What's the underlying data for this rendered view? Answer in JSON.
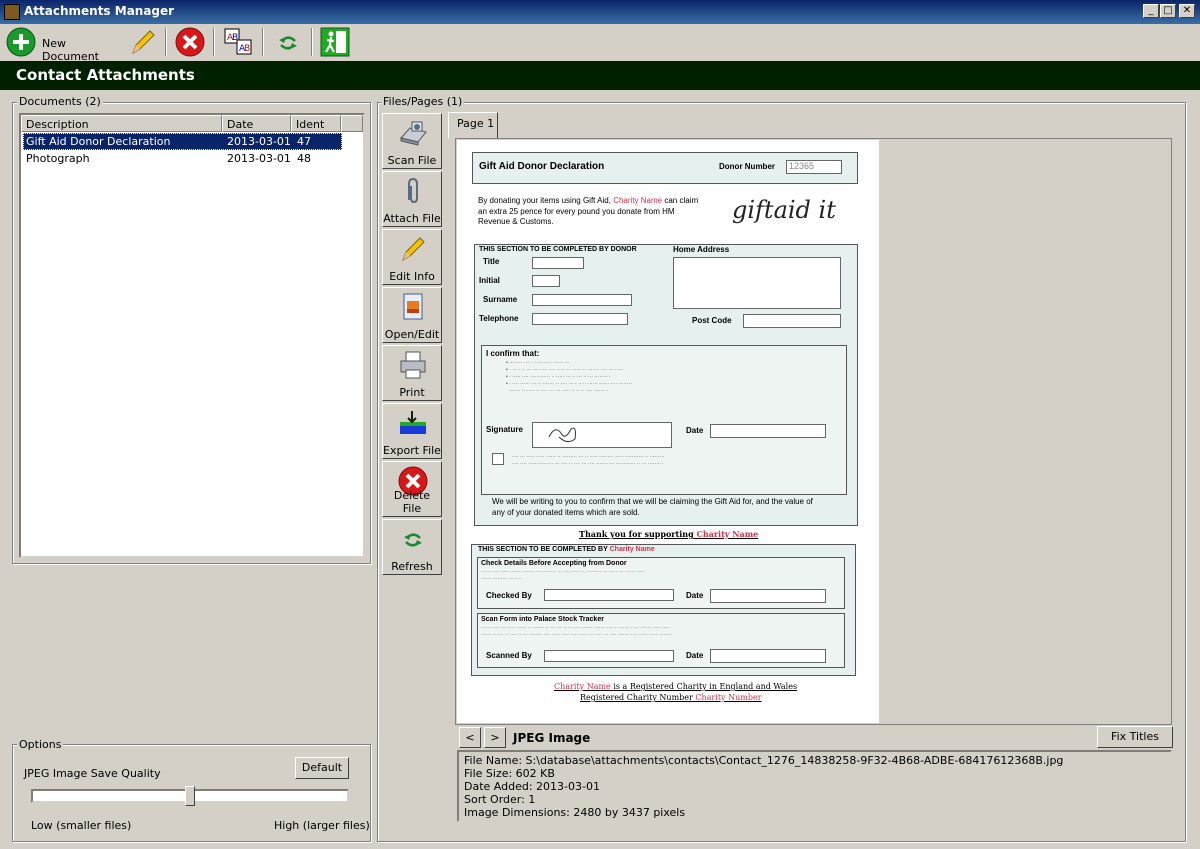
{
  "window": {
    "title": "Attachments Manager",
    "controls": [
      "_",
      "□",
      "✕"
    ]
  },
  "toolbar": {
    "new_document_label": "New Document"
  },
  "header": {
    "title": "Contact Attachments"
  },
  "documents": {
    "group_label": "Documents (2)",
    "columns": [
      "Description",
      "Date",
      "Ident"
    ],
    "rows": [
      {
        "description": "Gift Aid Donor Declaration",
        "date": "2013-03-01",
        "ident": "47",
        "selected": true
      },
      {
        "description": "Photograph",
        "date": "2013-03-01",
        "ident": "48",
        "selected": false
      }
    ]
  },
  "options": {
    "group_label": "Options",
    "quality_label": "JPEG Image Save Quality",
    "default_button": "Default",
    "low_label": "Low (smaller files)",
    "high_label": "High (larger files)",
    "quality_fraction": 0.5
  },
  "files": {
    "group_label": "Files/Pages (1)",
    "buttons": [
      "Scan File",
      "Attach File",
      "Edit Info",
      "Open/Edit",
      "Print",
      "Export File",
      "Delete File",
      "Refresh"
    ],
    "tab_label": "Page 1",
    "prev": "<",
    "next": ">",
    "image_type": "JPEG Image",
    "fix_titles": "Fix Titles",
    "info": {
      "file_name": "File Name: S:\\database\\attachments\\contacts\\Contact_1276_14838258-9F32-4B68-ADBE-68417612368B.jpg",
      "file_size": "File Size: 602 KB",
      "date_added": "Date Added: 2013-03-01",
      "sort_order": "Sort Order: 1",
      "dimensions": "Image Dimensions: 2480 by 3437 pixels"
    }
  },
  "doc": {
    "title": "Gift Aid Donor Declaration",
    "donor_number_label": "Donor Number",
    "donor_number": "12365",
    "intro_1": "By donating your items using Gift Aid,",
    "charity_name": "Charity Name",
    "intro_1b": "can claim",
    "intro_2": "an extra 25 pence for every pound you donate from HM",
    "intro_3": "Revenue & Customs.",
    "logo": "giftaid it",
    "section_donor": "THIS SECTION TO BE COMPLETED BY DONOR",
    "home_address": "Home Address",
    "title_label": "Title",
    "initial_label": "Initial",
    "surname_label": "Surname",
    "telephone_label": "Telephone",
    "postcode_label": "Post Code",
    "confirm_heading": "I confirm that:",
    "signature_label": "Signature",
    "date_label": "Date",
    "writing_1": "We will be writing to you to confirm that we will be claiming the Gift Aid for, and the value of",
    "writing_2": "any of your donated items which are sold.",
    "thank_you": "Thank you for supporting",
    "section_charity": "THIS SECTION TO BE COMPLETED BY",
    "check_heading": "Check Details Before Accepting from Donor",
    "checked_by": "Checked By",
    "scan_heading": "Scan Form into Palace Stock Tracker",
    "scanned_by": "Scanned By",
    "footer_1": "is a Registered Charity in England and Wales",
    "footer_2": "Registered Charity Number",
    "charity_number": "Charity Number"
  }
}
